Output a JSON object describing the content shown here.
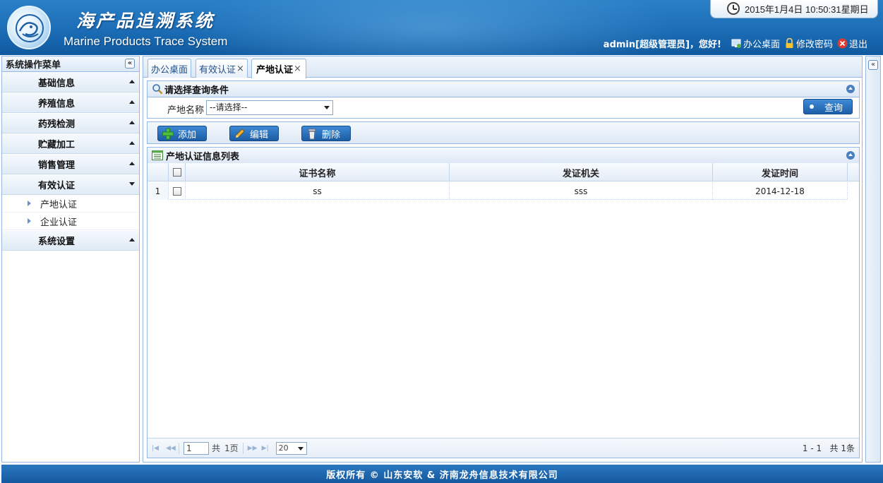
{
  "header": {
    "title_cn": "海产品追溯系统",
    "title_en": "Marine Products Trace System",
    "datetime": "2015年1月4日  10:50:31星期日",
    "greeting": "admin[超级管理员]，您好!",
    "links": {
      "desktop": "办公桌面",
      "change_password": "修改密码",
      "logout": "退出"
    }
  },
  "sidebar": {
    "title": "系统操作菜单",
    "collapse_glyph": "«",
    "items": [
      {
        "label": "基础信息",
        "state": "collapsed"
      },
      {
        "label": "养殖信息",
        "state": "collapsed"
      },
      {
        "label": "药残检测",
        "state": "collapsed"
      },
      {
        "label": "贮藏加工",
        "state": "collapsed"
      },
      {
        "label": "销售管理",
        "state": "collapsed"
      },
      {
        "label": "有效认证",
        "state": "expanded",
        "children": [
          "产地认证",
          "企业认证"
        ]
      },
      {
        "label": "系统设置",
        "state": "collapsed"
      }
    ]
  },
  "tabs": [
    {
      "label": "办公桌面",
      "closable": false
    },
    {
      "label": "有效认证",
      "closable": true
    },
    {
      "label": "产地认证",
      "closable": true,
      "active": true
    }
  ],
  "tab_close_glyph": "×",
  "search": {
    "title": "请选择查询条件",
    "field_label": "产地名称",
    "select_value": "--请选择--",
    "query_button": "查询"
  },
  "toolbar": {
    "add": "添加",
    "edit": "编辑",
    "delete": "删除"
  },
  "list": {
    "title": "产地认证信息列表",
    "columns": [
      "证书名称",
      "发证机关",
      "发证时间"
    ],
    "rows": [
      {
        "index": "1",
        "name": "ss",
        "authority": "sss",
        "date": "2014-12-18"
      }
    ]
  },
  "pager": {
    "page": "1",
    "total_pages_prefix": "共",
    "total_pages": "1页",
    "page_size": "20",
    "summary": "1 - 1   共 1条"
  },
  "footer": {
    "copyright": "版权所有 © 山东安软 & 济南龙舟信息技术有限公司"
  },
  "colors": {
    "header_blue": "#1d6fb8",
    "border": "#95b8e7",
    "button_blue": "#1d5fa8"
  }
}
